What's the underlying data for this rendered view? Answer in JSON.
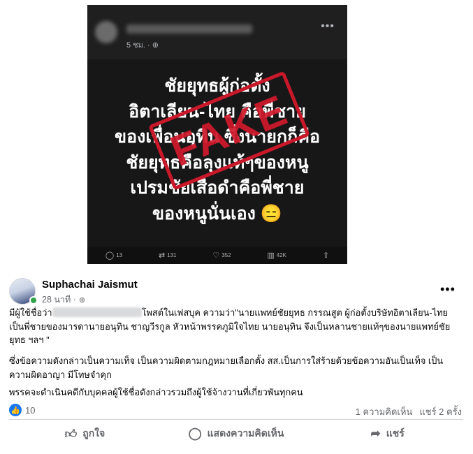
{
  "embedded_post": {
    "time": "5 ชม.",
    "globe_icon": "globe-icon",
    "more_icon": "more-icon",
    "text_lines": [
      "ชัยยุทธผู้ก่อตั้ง",
      "อิตาเลียน-ไทย คือพี่ชาย",
      "ของเพื่อนอุทิน ซึ่งนายกก็คือ",
      "ชัยยุทธคือลุงแท้ๆของหนู",
      "เปรมชัยเสือดำคือพี่ชาย",
      "ของหนูนั่นเอง 😑"
    ],
    "stamp": "FAKE",
    "stamp_color": "#d01a2c",
    "stats": [
      {
        "icon": "comment-icon",
        "glyph": "◯",
        "value": "13"
      },
      {
        "icon": "repost-icon",
        "glyph": "⇄",
        "value": "131"
      },
      {
        "icon": "heart-icon",
        "glyph": "♡",
        "value": "352"
      },
      {
        "icon": "views-icon",
        "glyph": "▥",
        "value": "42K"
      },
      {
        "icon": "share-icon",
        "glyph": "⇪",
        "value": ""
      }
    ]
  },
  "post": {
    "author": "Suphachai Jaismut",
    "time": "28 นาที ·",
    "para1_prefix": "มีผู้ใช้ชื่อว่า",
    "para1_rest": "โพสต์ในเฟสบุค ความว่า\"นายแพทย์ชัยยุทธ กรรณสูต ผู้ก่อตั้งบริษัทอิตาเลียน-ไทย เป็นพี่ชายของมารดานายอนุทิน ชาญวีรกูล หัวหน้าพรรคภูมิใจไทย นายอนุทิน จึงเป็นหลานชายแท้ๆของนายแพทย์ชัยยุทธ ฯลฯ \"",
    "para2": "ซึ่งข้อความดังกล่าวเป็นความเท็จ เป็นความผิดตามกฎหมายเลือกตั้ง สส.เป็นการใส่ร้ายด้วยข้อความอันเป็นเท็จ เป็นความผิดอาญา มีโทษจำคุก",
    "para3": "พรรคจะดำเนินคดีกับบุคคลผู้ใช้ชื่อดังกล่าวรวมถึงผู้ใช้จ้างวานที่เกี่ยวพันทุกคน",
    "like_count": "10",
    "comments": "1 ความคิดเห็น",
    "shares": "แชร์ 2 ครั้ง",
    "actions": {
      "like": "ถูกใจ",
      "comment": "แสดงความคิดเห็น",
      "share": "แชร์"
    }
  }
}
